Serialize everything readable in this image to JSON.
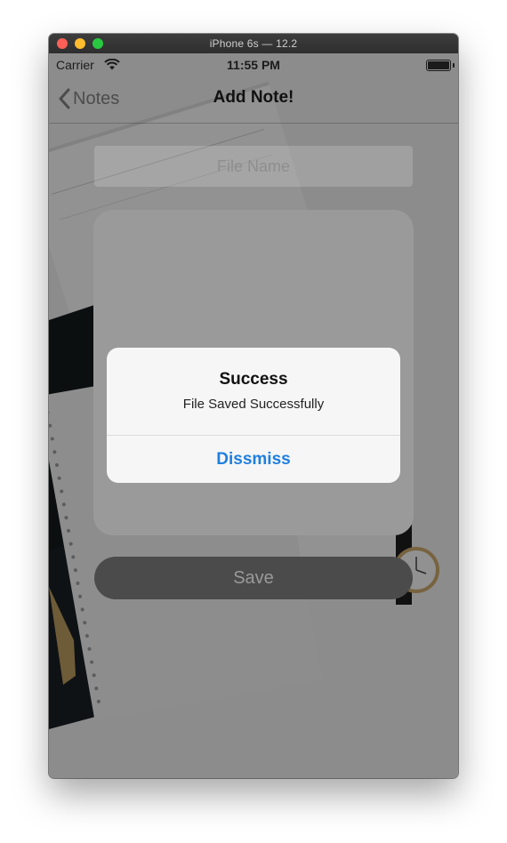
{
  "window": {
    "title": "iPhone 6s — 12.2"
  },
  "status_bar": {
    "carrier": "Carrier",
    "time": "11:55 PM",
    "wifi_icon": "wifi-icon",
    "battery_icon": "battery-icon"
  },
  "nav_bar": {
    "back_label": "Notes",
    "back_icon": "chevron-left-icon",
    "title": "Add Note!"
  },
  "form": {
    "file_name_placeholder": "File Name",
    "save_label": "Save"
  },
  "alert": {
    "title": "Success",
    "message": "File Saved Successfully",
    "action_label": "Dissmiss",
    "action_color": "#1f7fe0"
  },
  "colors": {
    "traffic_close": "#fe5f57",
    "traffic_minimize": "#febc2e",
    "traffic_maximize": "#28c840"
  }
}
